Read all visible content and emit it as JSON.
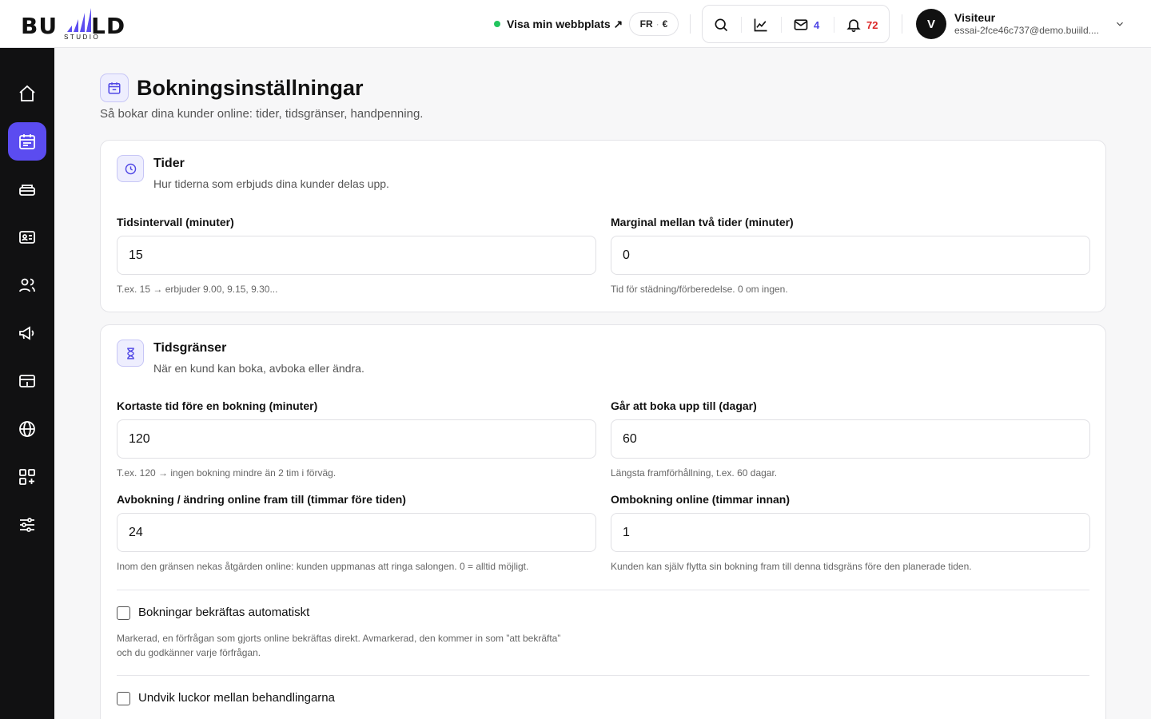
{
  "brand": {
    "logo_word_left": "BU",
    "logo_word_right": "LD",
    "logo_sub": "STUDIO"
  },
  "header": {
    "site_link": "Visa min webbplats ↗",
    "lang": "FR",
    "currency": "€",
    "mail_count": "4",
    "notif_count": "72",
    "user_initial": "V",
    "user_name": "Visiteur",
    "user_email": "essai-2fce46c737@demo.buiild...."
  },
  "sidebar": {
    "items": [
      {
        "icon": "home-icon"
      },
      {
        "icon": "calendar-icon",
        "active": true
      },
      {
        "icon": "services-icon"
      },
      {
        "icon": "contact-card-icon"
      },
      {
        "icon": "users-icon"
      },
      {
        "icon": "megaphone-icon"
      },
      {
        "icon": "payment-icon"
      },
      {
        "icon": "globe-icon"
      },
      {
        "icon": "apps-icon"
      },
      {
        "icon": "sliders-icon"
      }
    ]
  },
  "page": {
    "title": "Bokningsinställningar",
    "subtitle": "Så bokar dina kunder online: tider, tidsgränser, handpenning."
  },
  "times": {
    "title": "Tider",
    "subtitle": "Hur tiderna som erbjuds dina kunder delas upp.",
    "interval_label": "Tidsintervall (minuter)",
    "interval_value": "15",
    "interval_help": "T.ex. 15 → erbjuder 9.00, 9.15, 9.30...",
    "margin_label": "Marginal mellan två tider (minuter)",
    "margin_value": "0",
    "margin_help": "Tid för städning/förberedelse. 0 om ingen."
  },
  "limits": {
    "title": "Tidsgränser",
    "subtitle": "När en kund kan boka, avboka eller ändra.",
    "min_label": "Kortaste tid före en bokning (minuter)",
    "min_value": "120",
    "min_help": "T.ex. 120 → ingen bokning mindre än 2 tim i förväg.",
    "max_label": "Går att boka upp till (dagar)",
    "max_value": "60",
    "max_help": "Längsta framförhållning, t.ex. 60 dagar.",
    "cancel_label": "Avbokning / ändring online fram till (timmar före tiden)",
    "cancel_value": "24",
    "cancel_help": "Inom den gränsen nekas åtgärden online: kunden uppmanas att ringa salongen. 0 = alltid möjligt.",
    "rebook_label": "Ombokning online (timmar innan)",
    "rebook_value": "1",
    "rebook_help": "Kunden kan själv flytta sin bokning fram till denna tidsgräns före den planerade tiden.",
    "auto_confirm_label": "Bokningar bekräftas automatiskt",
    "auto_confirm_checked": false,
    "auto_confirm_help": "Markerad, en förfrågan som gjorts online bekräftas direkt. Avmarkerad, den kommer in som ”att bekräfta” och du godkänner varje förfrågan.",
    "avoid_gaps_label": "Undvik luckor mellan behandlingarna",
    "avoid_gaps_checked": false
  },
  "colors": {
    "accent": "#5b4cf0",
    "online": "#22c55e",
    "notif": "#dc2626",
    "mail": "#4f46e5"
  }
}
